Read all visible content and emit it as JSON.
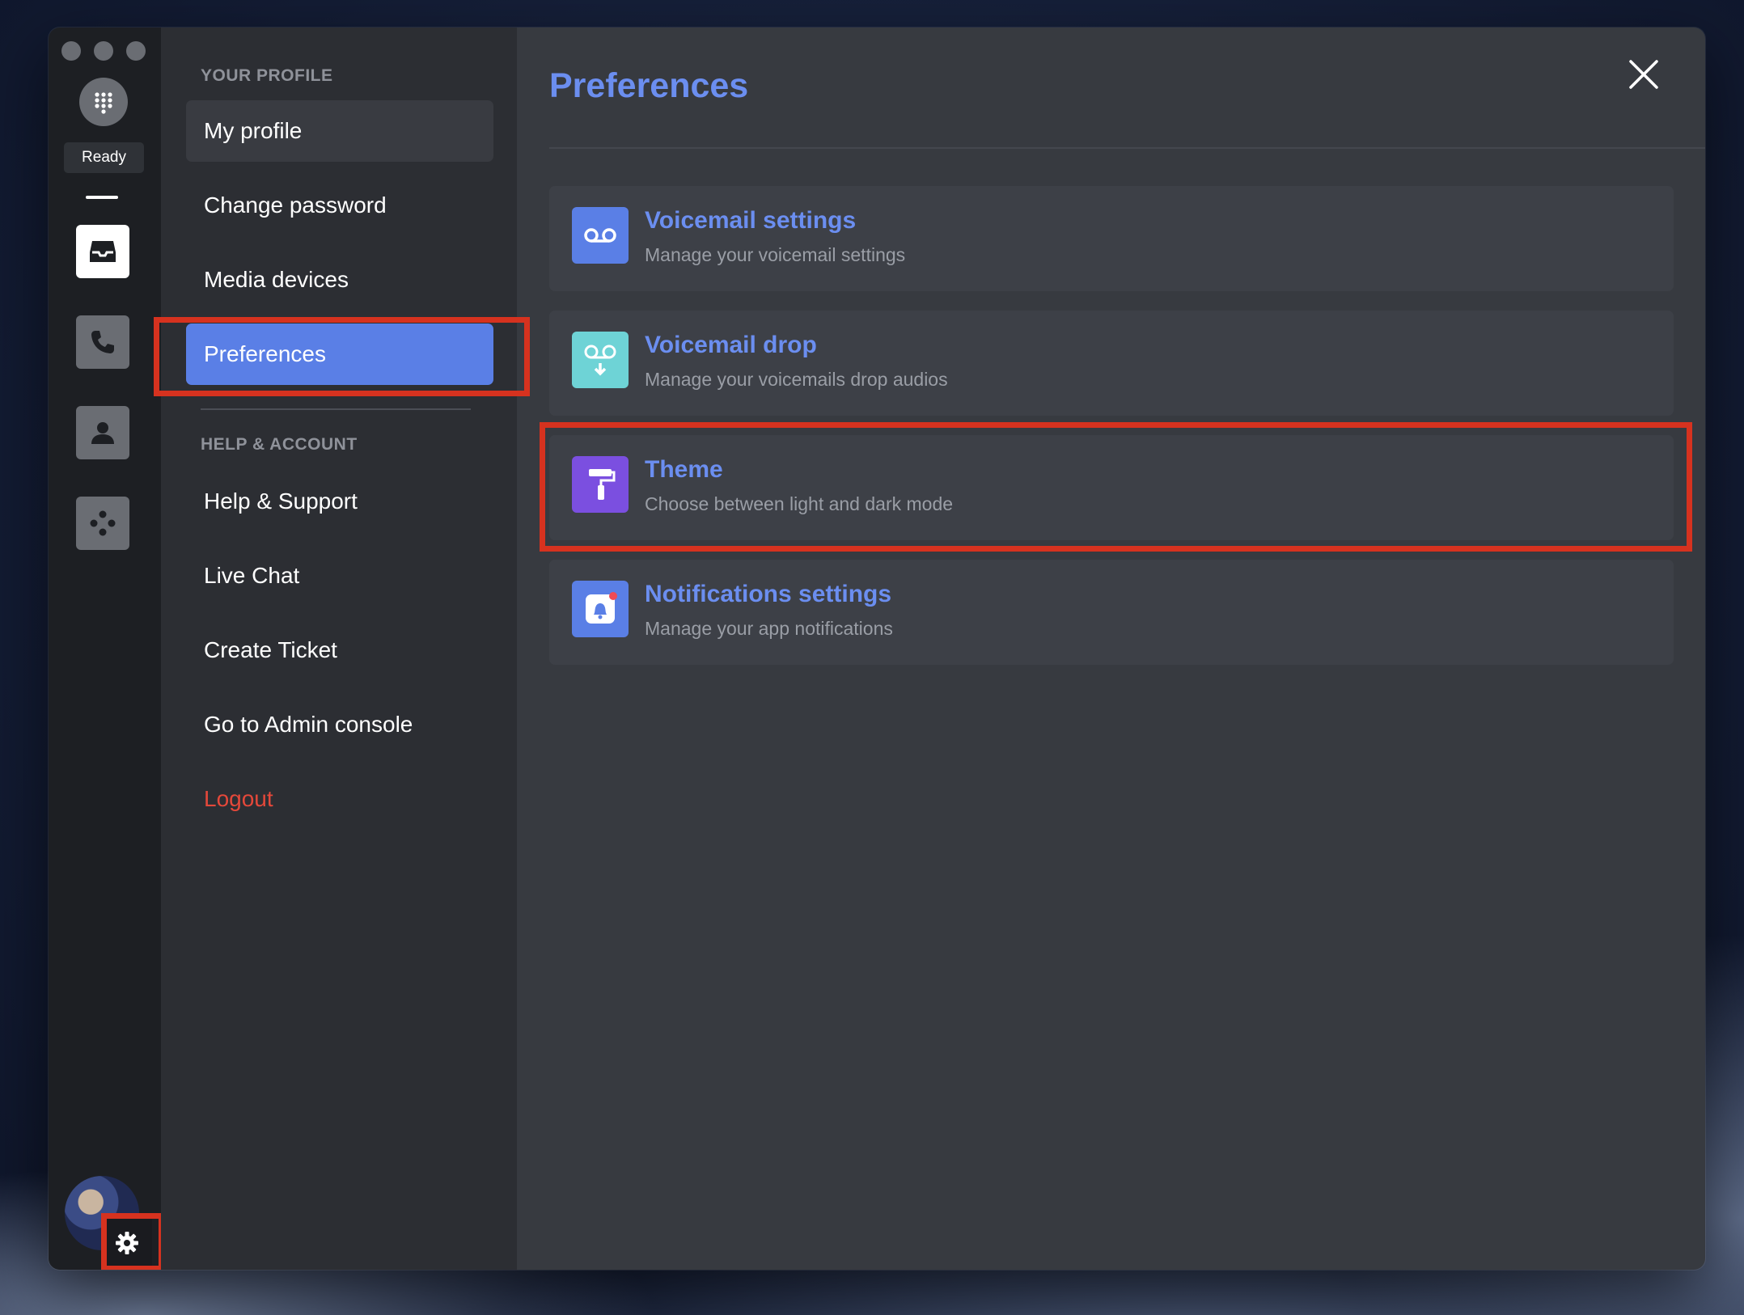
{
  "rail": {
    "status": "Ready",
    "dialpad_icon": "dialpad-icon",
    "items": [
      {
        "icon": "inbox-icon",
        "active": true
      },
      {
        "icon": "phone-icon",
        "active": false
      },
      {
        "icon": "contacts-icon",
        "active": false
      },
      {
        "icon": "integrations-icon",
        "active": false
      }
    ],
    "settings_icon": "gear-icon"
  },
  "nav": {
    "sections": [
      {
        "heading": "YOUR PROFILE",
        "items": [
          "My profile",
          "Change password",
          "Media devices",
          "Preferences"
        ]
      },
      {
        "heading": "HELP & ACCOUNT",
        "items": [
          "Help & Support",
          "Live Chat",
          "Create Ticket",
          "Go to Admin console",
          "Logout"
        ]
      }
    ],
    "active": "Preferences"
  },
  "main": {
    "title": "Preferences",
    "cards": [
      {
        "title": "Voicemail settings",
        "subtitle": "Manage your voicemail settings",
        "icon": "voicemail-icon",
        "icon_color": "#5a7fe6"
      },
      {
        "title": "Voicemail drop",
        "subtitle": "Manage your voicemails drop audios",
        "icon": "voicemail-drop-icon",
        "icon_color": "#6ed3d6"
      },
      {
        "title": "Theme",
        "subtitle": "Choose between light and dark mode",
        "icon": "paint-roller-icon",
        "icon_color": "#7b4fe0"
      },
      {
        "title": "Notifications settings",
        "subtitle": "Manage your app notifications",
        "icon": "bell-icon",
        "icon_color": "#5a7fe6"
      }
    ]
  },
  "colors": {
    "accent": "#6b8ef0",
    "active_nav": "#5a7fe6",
    "highlight": "#d6321f",
    "logout": "#e4483a"
  }
}
